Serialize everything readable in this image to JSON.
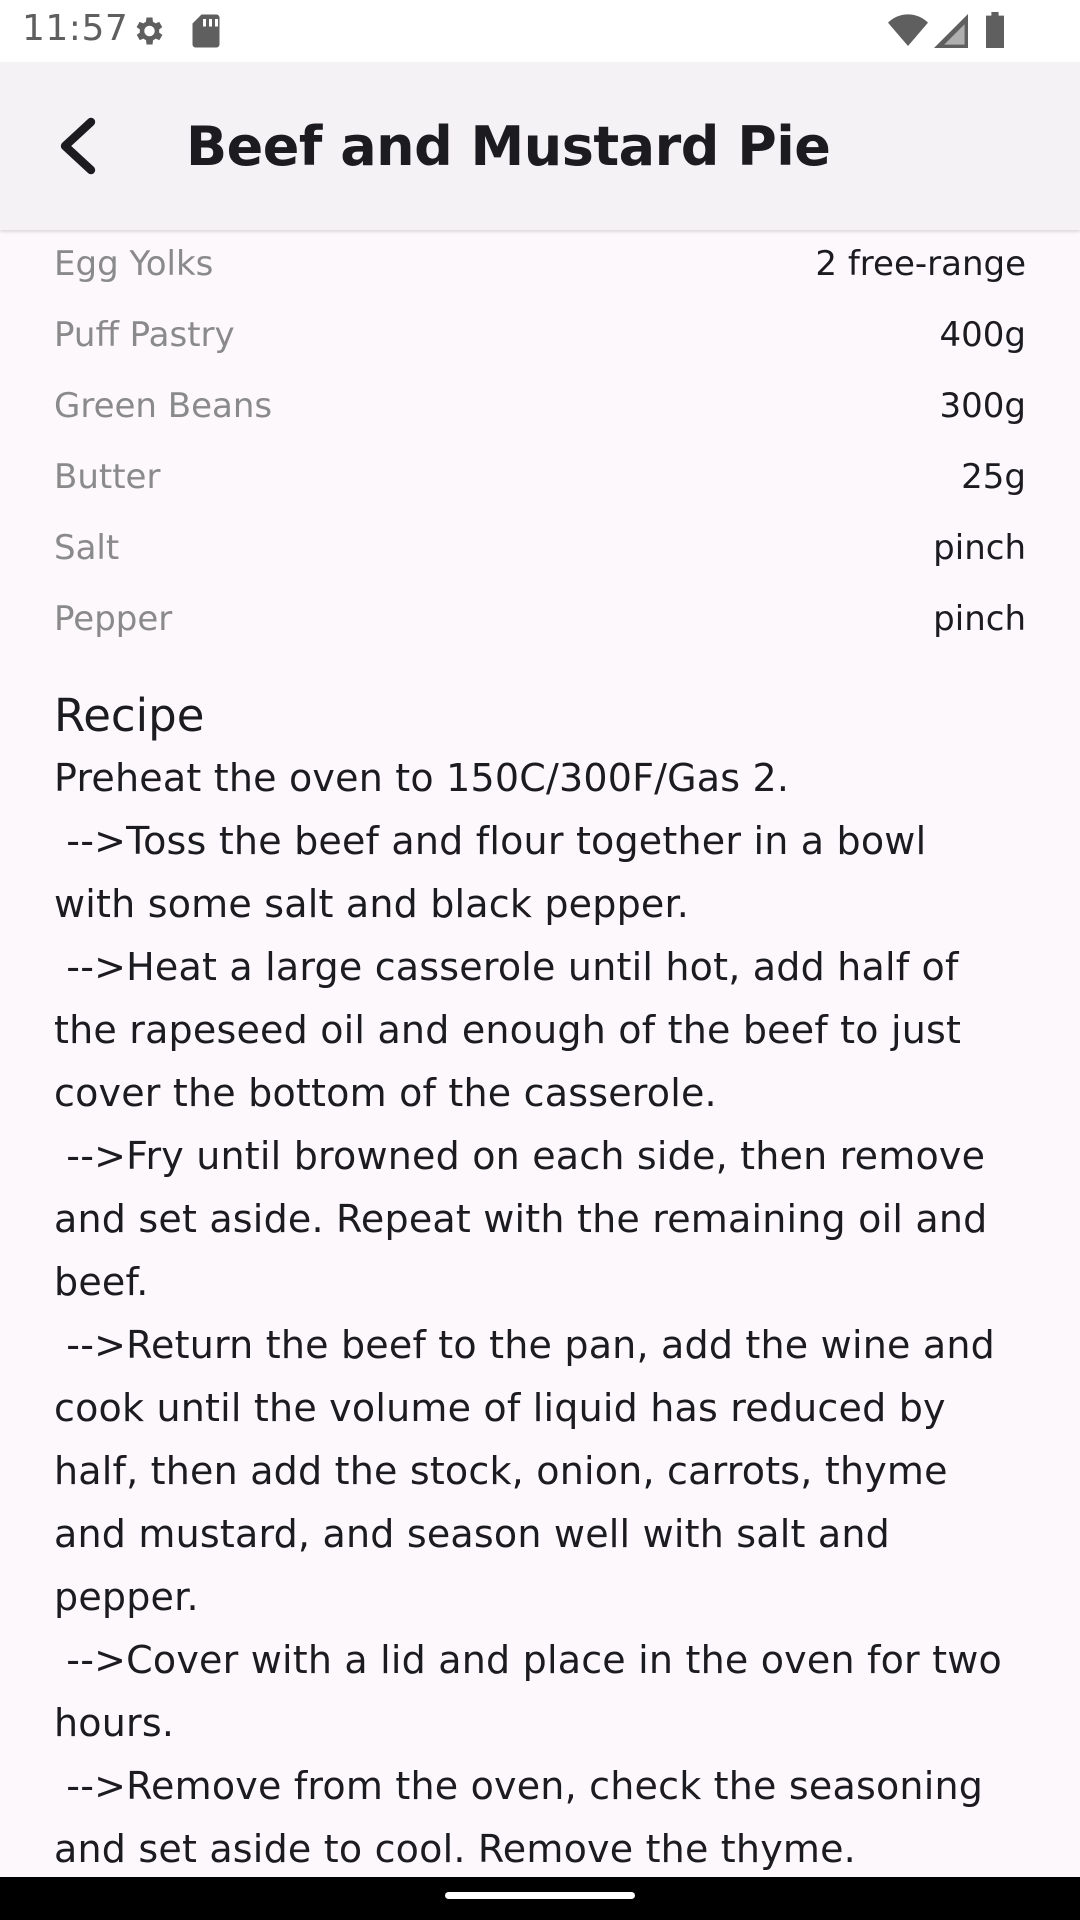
{
  "status_bar": {
    "time": "11:57",
    "icons": [
      "settings-icon",
      "sd-card-icon",
      "wifi-icon",
      "signal-icon",
      "battery-icon"
    ]
  },
  "app_bar": {
    "title": "Beef and Mustard Pie",
    "back_icon": "back-arrow-icon"
  },
  "ingredients": [
    {
      "name": "Egg Yolks",
      "quantity": "2 free-range"
    },
    {
      "name": "Puff Pastry",
      "quantity": "400g"
    },
    {
      "name": "Green Beans",
      "quantity": "300g"
    },
    {
      "name": "Butter",
      "quantity": "25g"
    },
    {
      "name": "Salt",
      "quantity": "pinch"
    },
    {
      "name": "Pepper",
      "quantity": "pinch"
    }
  ],
  "recipe": {
    "heading": "Recipe",
    "text": "Preheat the oven to 150C/300F/Gas 2.\n -->Toss the beef and flour together in a bowl\nwith some salt and black pepper.\n -->Heat a large casserole until hot, add half of\nthe rapeseed oil and enough of the beef to just\ncover the bottom of the casserole.\n -->Fry until browned on each side, then remove\nand set aside. Repeat with the remaining oil and\nbeef.\n -->Return the beef to the pan, add the wine and\ncook until the volume of liquid has reduced by\nhalf, then add the stock, onion, carrots, thyme\nand mustard, and season well with salt and\npepper.\n -->Cover with a lid and place in the oven for two\nhours.\n -->Remove from the oven, check the seasoning\nand set aside to cool. Remove the thyme."
  },
  "colors": {
    "background": "#fcf8fc",
    "app_bar": "#f5f2f5",
    "ingredient_name": "#8a8a8a",
    "text": "#1c1b1f"
  }
}
